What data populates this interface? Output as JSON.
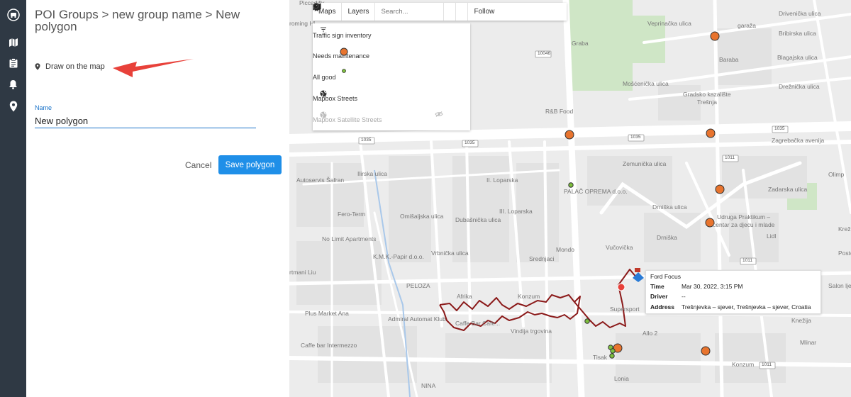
{
  "panel": {
    "breadcrumb": "POI Groups > new group name > New polygon",
    "draw_label": "Draw on the map",
    "name_label": "Name",
    "name_value": "New polygon",
    "cancel_label": "Cancel",
    "save_label": "Save polygon"
  },
  "toolbar": {
    "maps_label": "Maps",
    "layers_label": "Layers",
    "search_placeholder": "Search...",
    "follow_label": "Follow"
  },
  "layers_panel": {
    "group_label": "Traffic sign inventory",
    "needs_maintenance_label": "Needs maintenance",
    "all_good_label": "All good",
    "streets_label": "Mapbox Streets",
    "satellite_label": "Mapbox Satellite Streets"
  },
  "popup": {
    "vehicle": "Ford Focus",
    "time_key": "Time",
    "time_value": "Mar 30, 2022, 3:15 PM",
    "driver_key": "Driver",
    "driver_value": "--",
    "address_key": "Address",
    "address_value": "Trešnjevka – sjever, Trešnjevka – sjever, Croatia"
  },
  "map_labels": {
    "picradilly": "Piccadilly",
    "croming": "roming Hi",
    "veprinacka": "Veprinačka ulica",
    "drivenicka": "Drivenička ulica",
    "bribirska": "Bribirska ulica",
    "garaza": "garaža",
    "blagajska": "Blagajska ulica",
    "baraba": "Baraba",
    "graba": "Graba",
    "mosceniceva": "Mošćenička ulica",
    "dreznicka": "Drežnička ulica",
    "gradsko": "Gradsko kazalište",
    "tresnja": "Trešnja",
    "rb_food": "R&B Food",
    "zagrebacka": "Zagrebačka avenija",
    "zemunicka": "Zemunička ulica",
    "olimp": "Olimp",
    "autoservis": "Autoservis Šafran",
    "ilirska": "Ilirska ulica",
    "loparska2": "II. Loparska",
    "loparska3": "III. Loparska",
    "palac": "PALAČ OPREMA d.o.o.",
    "zadarska": "Zadarska ulica",
    "ferroterm": "Fero-Term",
    "omisaljska": "Omišaljska ulica",
    "dubasnicka": "Dubašnička ulica",
    "drniska_ulica": "Drniška ulica",
    "udruga1": "Udruga Praktikum –",
    "udruga2": "centar za djecu i mlade",
    "no_limit": "No Limit Apartments",
    "kmk": "K.M.K.-Papir d.o.o.",
    "vrbnicka": "Vrbnička ulica",
    "mondo": "Mondo",
    "vukovica": "Vučovička",
    "drniska": "Drniška",
    "lidl": "Lidl",
    "krez": "Krež",
    "postolar": "Postolar i",
    "artmani": "rtmani Liu",
    "peloza": "PELOZA",
    "srednjaci": "Srednjaci",
    "afrika": "Afrika",
    "konzum1": "Konzum",
    "sup": "Supersport",
    "salon": "Salon ljepo",
    "plus_market": "Plus Market Ana",
    "admiral": "Admiral Automat Klub",
    "caffe_cafe": "Caffe Bar Cafe...",
    "vindija": "Vindija trgovina",
    "allo": "Allo 2",
    "knezija": "Knežija",
    "caffe_bar": "Caffe bar Intermezzo",
    "mlinar": "Mlinar",
    "tisak": "Tisak",
    "konzum2": "Konzum",
    "nina": "NINA",
    "lonia": "Lonia",
    "road_10046": "10046",
    "road_1035a": "1035",
    "road_1035b": "1035",
    "road_1035c": "1035",
    "road_1035d": "1035",
    "road_1035e": "1035",
    "road_1011a": "1011",
    "road_1011b": "1011",
    "road_1011c": "1011"
  },
  "colors": {
    "needs_maintenance": "#e8742e",
    "all_good": "#7dbf3d",
    "track": "#8b1a1a",
    "accent": "#1f8fe8"
  }
}
